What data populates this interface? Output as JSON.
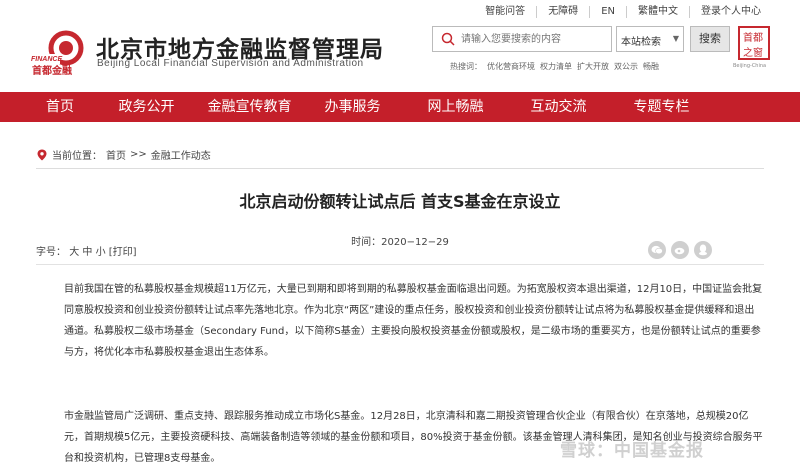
{
  "topbar": {
    "links": [
      "智能问答",
      "无障碍",
      "EN",
      "繁體中文",
      "登录个人中心"
    ]
  },
  "header": {
    "logo_cn": "北京市地方金融监督管理局",
    "logo_en": "Beijing Local Financial Supervision and Administration",
    "logo_badge": "FINANCE 首都金融",
    "search_placeholder": "请输入您要搜索的内容",
    "search_scope": "本站检索",
    "search_button": "搜索",
    "hot_label": "热搜词：",
    "hot_terms": [
      "优化营商环境",
      "权力清单",
      "扩大开放",
      "双公示",
      "畅融"
    ],
    "seal_text": "首都之窗",
    "seal_sub": "Beijing-China"
  },
  "nav": {
    "items": [
      "首页",
      "政务公开",
      "金融宣传教育",
      "办事服务",
      "网上畅融",
      "互动交流",
      "专题专栏"
    ]
  },
  "breadcrumb": {
    "label": "当前位置：",
    "items": [
      "首页",
      ">>",
      "金融工作动态"
    ]
  },
  "article": {
    "title": "北京启动份额转让试点后 首支S基金在京设立",
    "time_label": "时间：",
    "time": "2020−12−29",
    "fontsize_label": "字号：",
    "fontsize_options": [
      "大",
      "中",
      "小"
    ],
    "print": "[打印]",
    "paragraphs": [
      "目前我国在管的私募股权基金规模超11万亿元，大量已到期和即将到期的私募股权基金面临退出问题。为拓宽股权资本退出渠道，12月10日，中国证监会批复同意股权投资和创业投资份额转让试点率先落地北京。作为北京“两区”建设的重点任务，股权投资和创业投资份额转让试点将为私募股权基金提供缓释和退出通道。私募股权二级市场基金（Secondary Fund，以下简称S基金）主要投向股权投资基金份额或股权，是二级市场的重要买方，也是份额转让试点的重要参与方，将优化本市私募股权基金退出生态体系。",
      "市金融监管局广泛调研、重点支持、跟踪服务推动成立市场化S基金。12月28日，北京清科和嘉二期投资管理合伙企业（有限合伙）在京落地，总规模20亿元，首期规模5亿元，主要投资硬科技、高端装备制造等领域的基金份额和项目，80%投资于基金份额。该基金管理人清科集团，是知名创业与投资综合服务平台和投资机构，已管理8支母基金。"
    ]
  },
  "watermark": "雪球：中国基金报",
  "colors": {
    "brand_red": "#c41f2a"
  }
}
